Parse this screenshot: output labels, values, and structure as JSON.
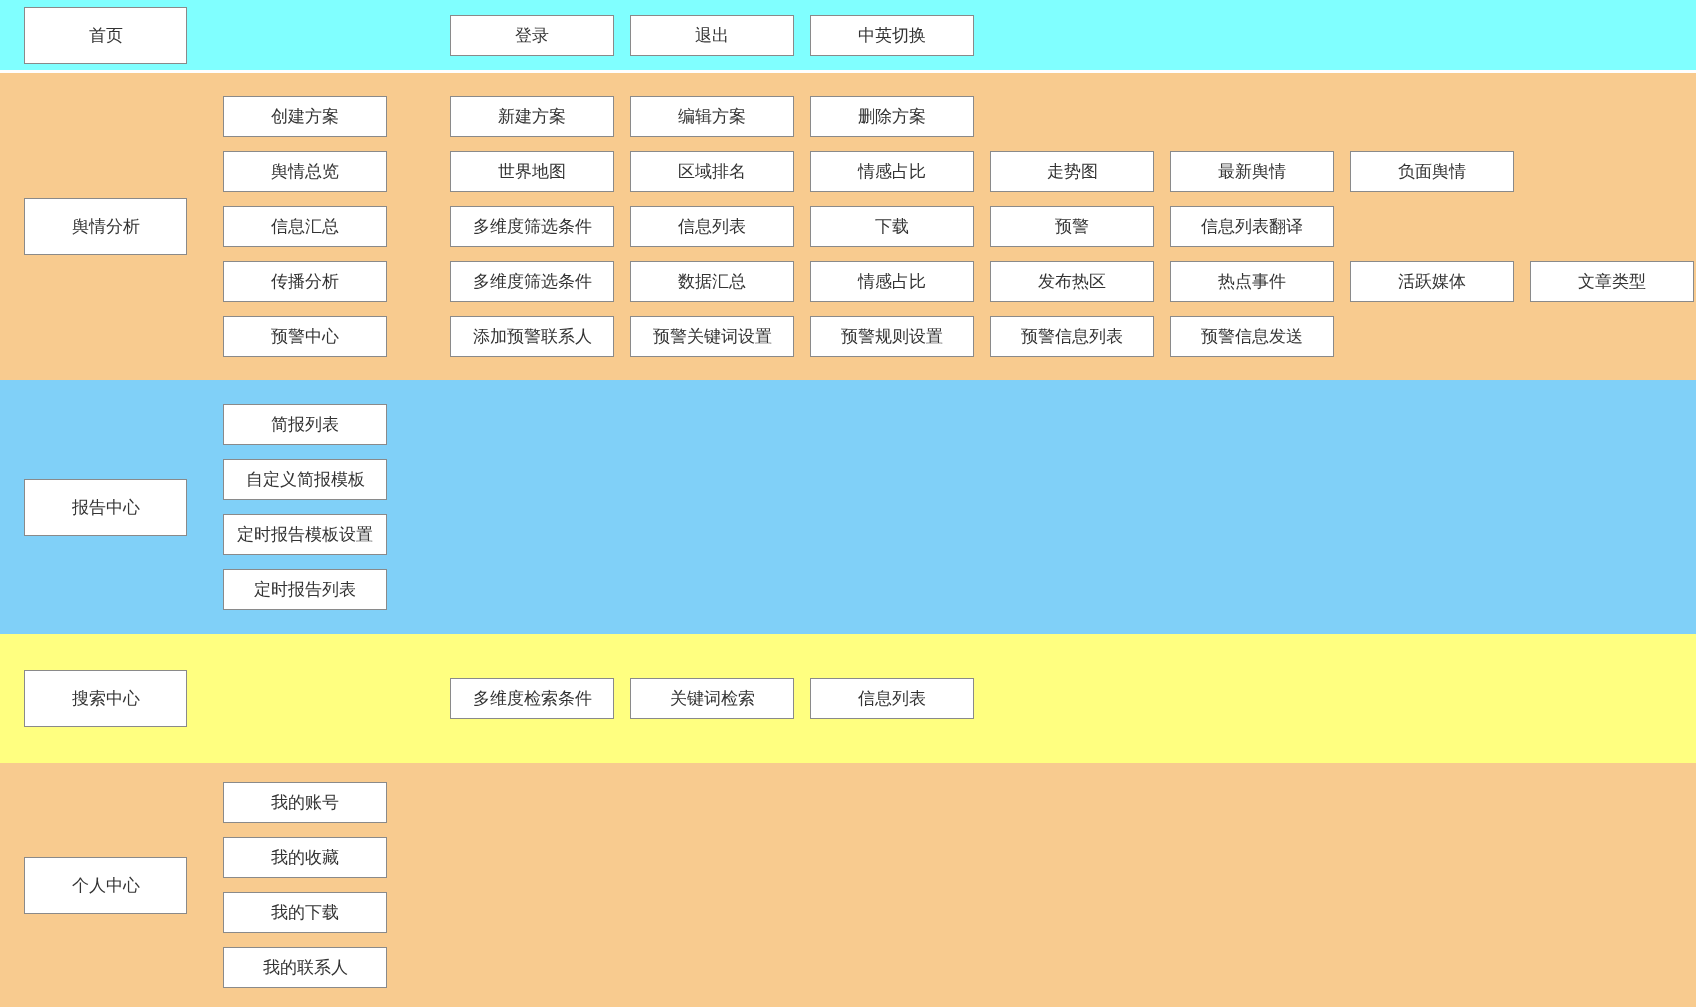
{
  "sections": [
    {
      "title": "首页",
      "color": "#80ffff",
      "rows": [
        {
          "items": [
            "登录",
            "退出",
            "中英切换"
          ]
        }
      ]
    },
    {
      "title": "舆情分析",
      "color": "#f8cb8f",
      "rows": [
        {
          "entry": "创建方案",
          "items": [
            "新建方案",
            "编辑方案",
            "删除方案"
          ]
        },
        {
          "entry": "舆情总览",
          "items": [
            "世界地图",
            "区域排名",
            "情感占比",
            "走势图",
            "最新舆情",
            "负面舆情"
          ]
        },
        {
          "entry": "信息汇总",
          "items": [
            "多维度筛选条件",
            "信息列表",
            "下载",
            "预警",
            "信息列表翻译"
          ]
        },
        {
          "entry": "传播分析",
          "items": [
            "多维度筛选条件",
            "数据汇总",
            "情感占比",
            "发布热区",
            "热点事件",
            "活跃媒体",
            "文章类型"
          ]
        },
        {
          "entry": "预警中心",
          "items": [
            "添加预警联系人",
            "预警关键词设置",
            "预警规则设置",
            "预警信息列表",
            "预警信息发送"
          ]
        }
      ]
    },
    {
      "title": "报告中心",
      "color": "#80d0f8",
      "rows": [
        {
          "entry": "简报列表",
          "items": []
        },
        {
          "entry": "自定义简报模板",
          "items": []
        },
        {
          "entry": "定时报告模板设置",
          "items": []
        },
        {
          "entry": "定时报告列表",
          "items": []
        }
      ]
    },
    {
      "title": "搜索中心",
      "color": "#ffff80",
      "rows": [
        {
          "items": [
            "多维度检索条件",
            "关键词检索",
            "信息列表"
          ]
        }
      ]
    },
    {
      "title": "个人中心",
      "color": "#f8cb8f",
      "rows": [
        {
          "entry": "我的账号",
          "items": []
        },
        {
          "entry": "我的收藏",
          "items": []
        },
        {
          "entry": "我的下载",
          "items": []
        },
        {
          "entry": "我的联系人",
          "items": []
        }
      ]
    }
  ]
}
